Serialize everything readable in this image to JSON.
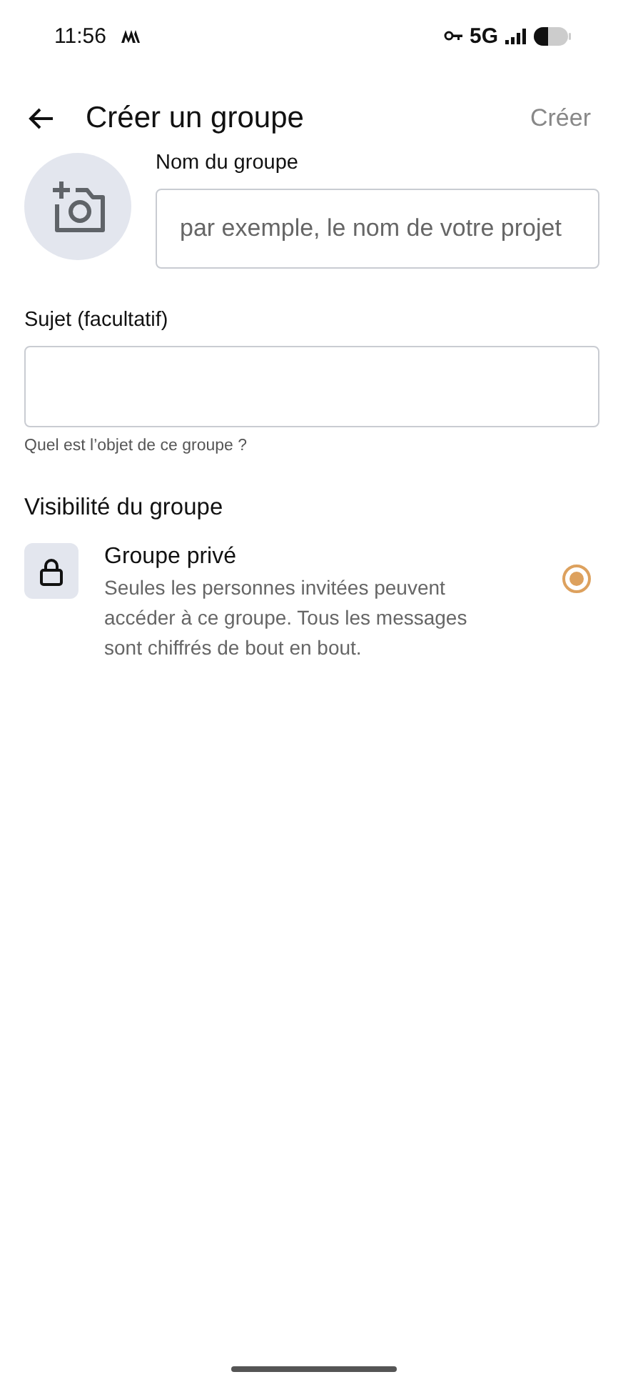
{
  "status_bar": {
    "time": "11:56",
    "network": "5G"
  },
  "header": {
    "title": "Créer un groupe",
    "action": "Créer"
  },
  "name_field": {
    "label": "Nom du groupe",
    "placeholder": "par exemple, le nom de votre projet"
  },
  "subject_field": {
    "label": "Sujet (facultatif)",
    "hint": "Quel est l’objet de ce groupe ?"
  },
  "visibility": {
    "heading": "Visibilité du groupe",
    "options": [
      {
        "title": "Groupe privé",
        "description": "Seules les personnes invitées peuvent accéder à ce groupe. Tous les messages sont chiffrés de bout en bout.",
        "selected": true
      }
    ]
  }
}
